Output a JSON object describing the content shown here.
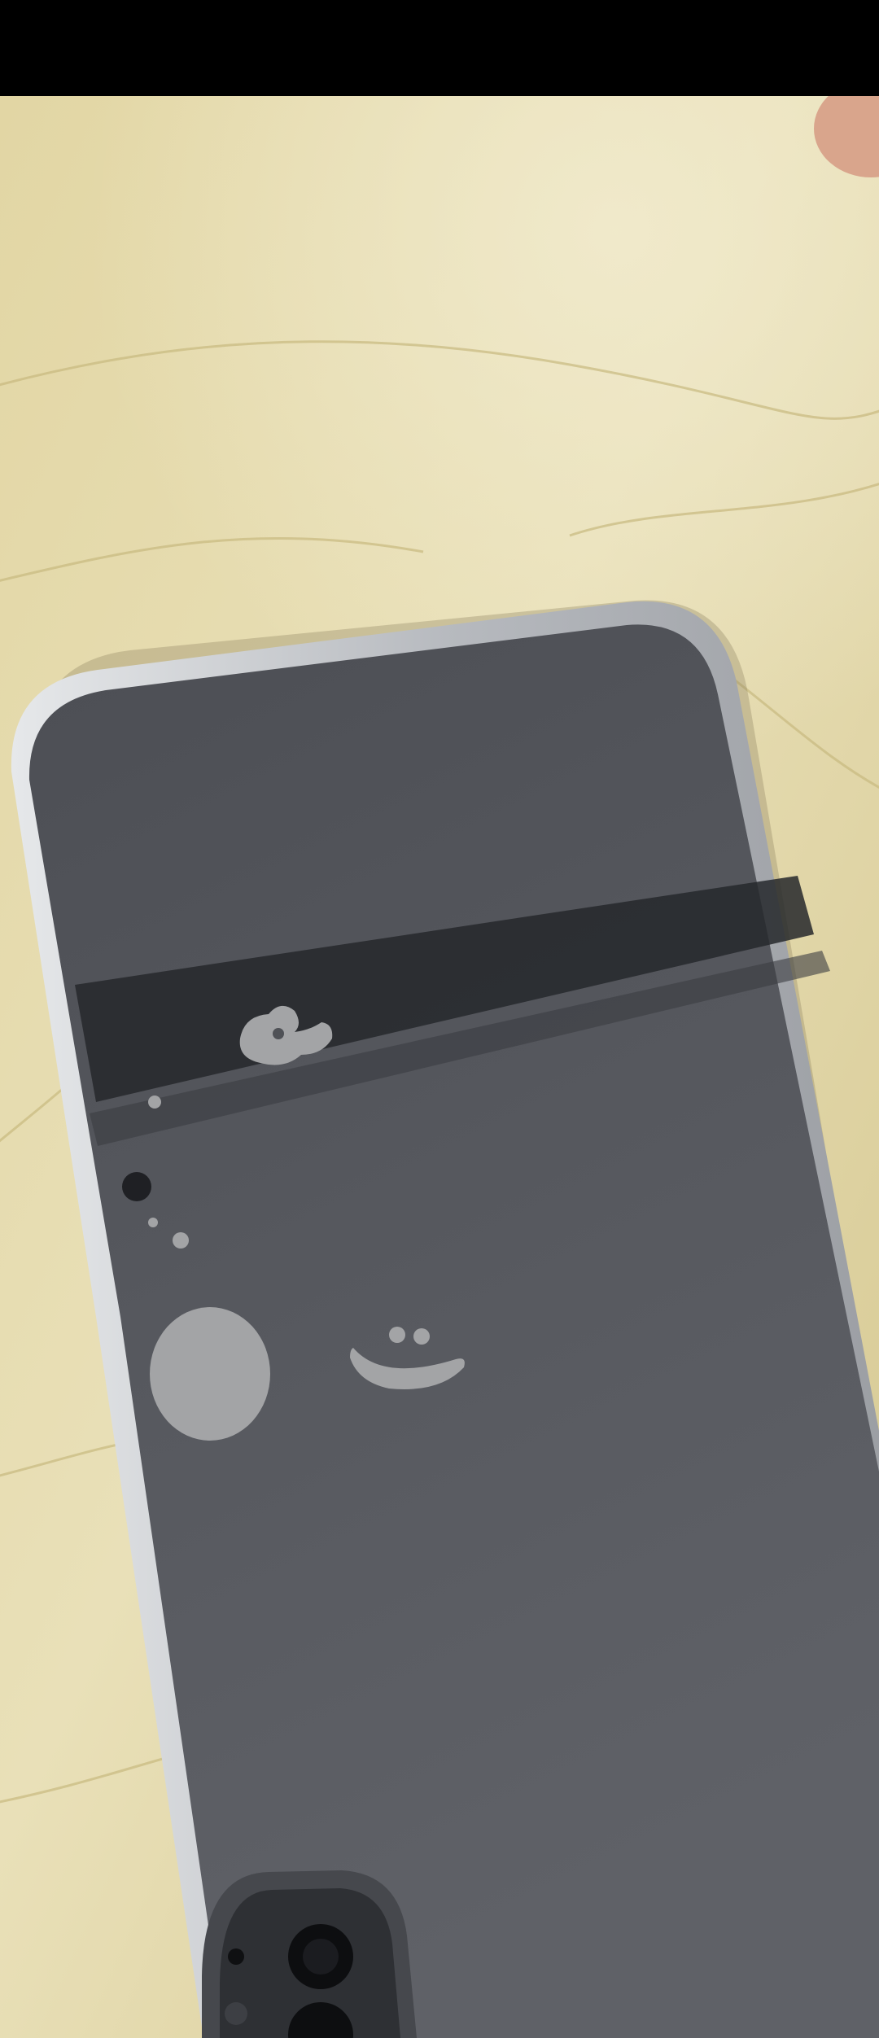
{
  "scene": {
    "type": "photo",
    "subject": "smartphone-face-down-on-leather-sofa",
    "colors": {
      "letterbox": "#000000",
      "leather_light": "#e7ddb3",
      "leather_mid": "#d6c992",
      "leather_shadow": "#c4b57c",
      "phone_back_glass_top": "#4d4f55",
      "phone_back_glass_bottom": "#5f6167",
      "phone_frame_silver": "#c9ccd0",
      "reflection_band": "#26282c",
      "sticker_gray": "#a3a4a6",
      "finger_skin": "#d9a58c"
    },
    "icons": {
      "stickers": [
        "paw-shaped-sticker",
        "round-sticker",
        "smiley-sticker"
      ],
      "camera": "camera-module-icon"
    }
  }
}
